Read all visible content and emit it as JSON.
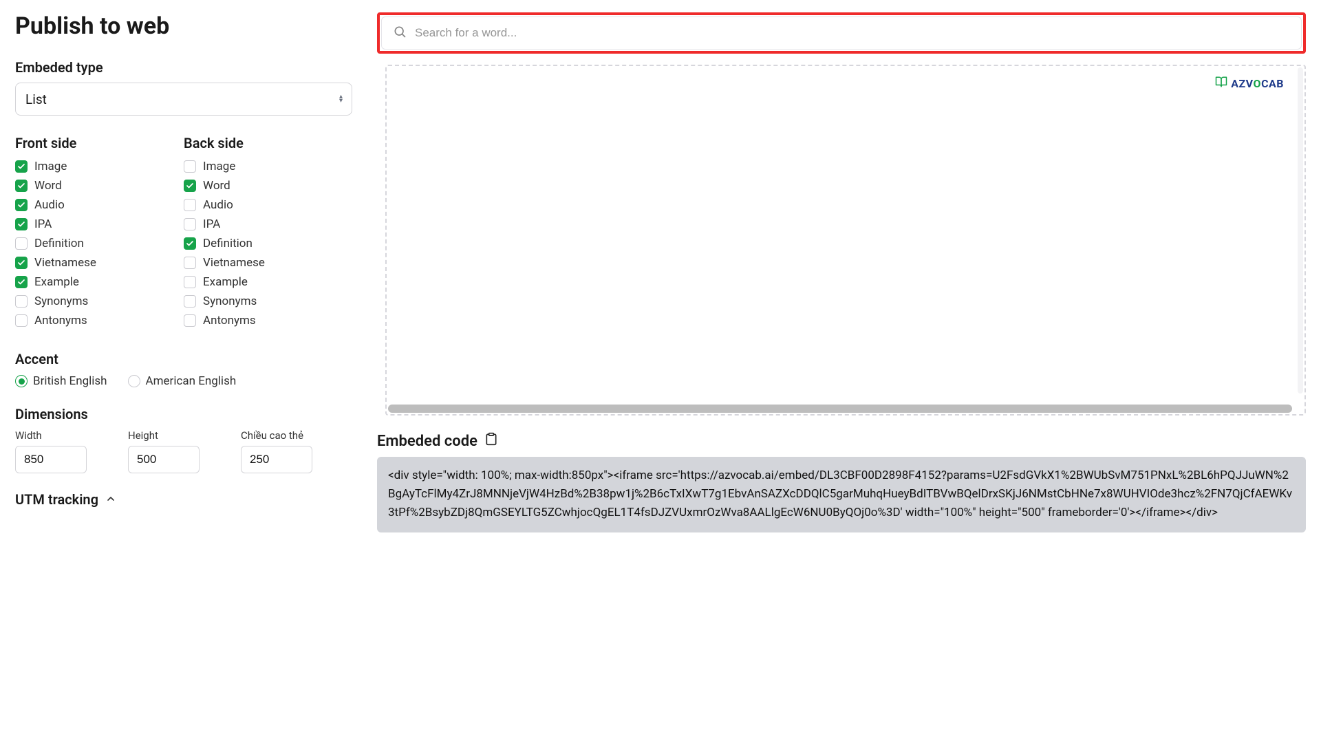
{
  "page": {
    "title": "Publish to web"
  },
  "embedType": {
    "label": "Embeded type",
    "value": "List"
  },
  "frontSide": {
    "title": "Front side",
    "items": [
      {
        "label": "Image",
        "checked": true
      },
      {
        "label": "Word",
        "checked": true
      },
      {
        "label": "Audio",
        "checked": true
      },
      {
        "label": "IPA",
        "checked": true
      },
      {
        "label": "Definition",
        "checked": false
      },
      {
        "label": "Vietnamese",
        "checked": true
      },
      {
        "label": "Example",
        "checked": true
      },
      {
        "label": "Synonyms",
        "checked": false
      },
      {
        "label": "Antonyms",
        "checked": false
      }
    ]
  },
  "backSide": {
    "title": "Back side",
    "items": [
      {
        "label": "Image",
        "checked": false
      },
      {
        "label": "Word",
        "checked": true
      },
      {
        "label": "Audio",
        "checked": false
      },
      {
        "label": "IPA",
        "checked": false
      },
      {
        "label": "Definition",
        "checked": true
      },
      {
        "label": "Vietnamese",
        "checked": false
      },
      {
        "label": "Example",
        "checked": false
      },
      {
        "label": "Synonyms",
        "checked": false
      },
      {
        "label": "Antonyms",
        "checked": false
      }
    ]
  },
  "accent": {
    "label": "Accent",
    "options": [
      {
        "label": "British English",
        "selected": true
      },
      {
        "label": "American English",
        "selected": false
      }
    ]
  },
  "dimensions": {
    "label": "Dimensions",
    "width": {
      "label": "Width",
      "value": "850"
    },
    "height": {
      "label": "Height",
      "value": "500"
    },
    "cardHeight": {
      "label": "Chiều cao thẻ",
      "value": "250"
    }
  },
  "utm": {
    "label": "UTM tracking"
  },
  "search": {
    "placeholder": "Search for a word..."
  },
  "brand": {
    "text": "AZVOCAB"
  },
  "embedCode": {
    "label": "Embeded code",
    "code": "<div style=\"width: 100%; max-width:850px\"><iframe src='https://azvocab.ai/embed/DL3CBF00D2898F4152?params=U2FsdGVkX1%2BWUbSvM751PNxL%2BL6hPQJJuWN%2BgAyTcFlMy4ZrJ8MNNjeVjW4HzBd%2B38pw1j%2B6cTxIXwT7g1EbvAnSAZXcDDQlC5garMuhqHueyBdITBVwBQelDrxSKjJ6NMstCbHNe7x8WUHVIOde3hcz%2FN7QjCfAEWKv3tPf%2BsybZDj8QmGSEYLTG5ZCwhjocQgEL1T4fsDJZVUxmrOzWva8AALlgEcW6NU0ByQOj0o%3D' width=\"100%\" height=\"500\" frameborder='0'></iframe></div>"
  }
}
